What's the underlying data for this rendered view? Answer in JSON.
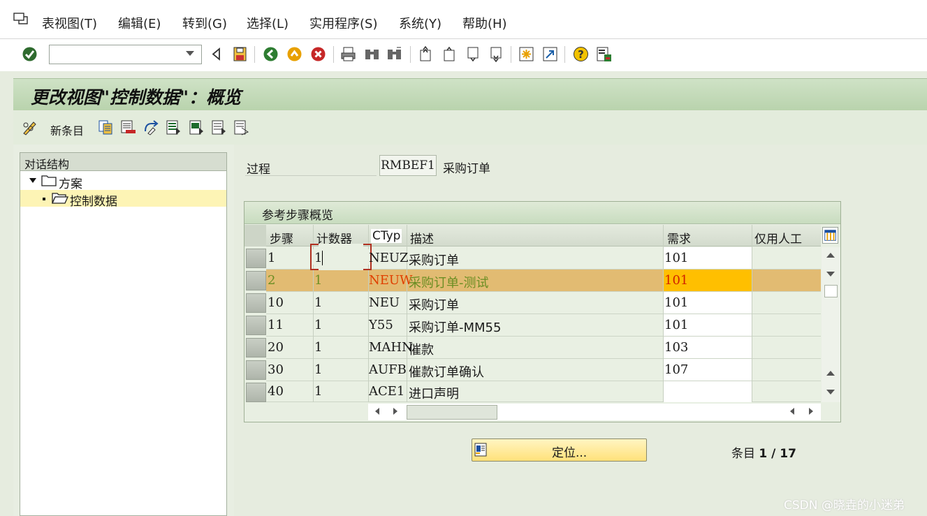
{
  "menu": [
    "表视图(T)",
    "编辑(E)",
    "转到(G)",
    "选择(L)",
    "实用程序(S)",
    "系统(Y)",
    "帮助(H)"
  ],
  "command_field": {
    "value": ""
  },
  "title": "更改视图\"控制数据\"：概览",
  "app_toolbar": {
    "new_entries_label": "新条目"
  },
  "tree": {
    "header": "对话结构",
    "items": [
      {
        "label": "方案",
        "expanded": true
      },
      {
        "label": "控制数据",
        "selected": true
      }
    ]
  },
  "process": {
    "label": "过程",
    "value": "RMBEF1",
    "description": "采购订单"
  },
  "table": {
    "title": "参考步骤概览",
    "columns": [
      "步骤",
      "计数器",
      "CTyp",
      "描述",
      "需求",
      "仅用人工"
    ],
    "rows": [
      {
        "step": "1",
        "counter": "1",
        "ctyp": "NEUZ",
        "desc": "采购订单",
        "req": "101",
        "manual": ""
      },
      {
        "step": "2",
        "counter": "1",
        "ctyp": "NEUW",
        "desc": "采购订单-测试",
        "req": "101",
        "manual": ""
      },
      {
        "step": "10",
        "counter": "1",
        "ctyp": "NEU",
        "desc": "采购订单",
        "req": "101",
        "manual": ""
      },
      {
        "step": "11",
        "counter": "1",
        "ctyp": "Y55",
        "desc": "采购订单-MM55",
        "req": "101",
        "manual": ""
      },
      {
        "step": "20",
        "counter": "1",
        "ctyp": "MAHN",
        "desc": "催款",
        "req": "103",
        "manual": ""
      },
      {
        "step": "30",
        "counter": "1",
        "ctyp": "AUFB",
        "desc": "催款订单确认",
        "req": "107",
        "manual": ""
      },
      {
        "step": "40",
        "counter": "1",
        "ctyp": "ACE1",
        "desc": "进口声明",
        "req": "",
        "manual": ""
      }
    ]
  },
  "locate_button": "定位...",
  "entries": {
    "label": "条目",
    "value": "1 / 17"
  },
  "watermark": "CSDN @晓垚的小迷弟",
  "colors": {
    "title_bar": "#c4dab9",
    "selected_row": "#e2bb72",
    "highlight_text": "#e04000",
    "locate_button": "#ffe58a"
  }
}
